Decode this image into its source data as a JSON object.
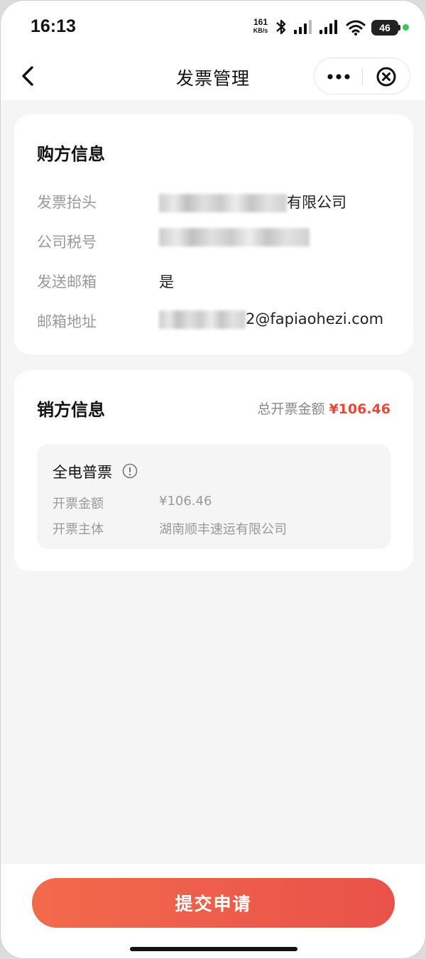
{
  "status_bar": {
    "time": "16:13",
    "net_speed_value": "161",
    "net_speed_unit": "KB/s",
    "battery": "46",
    "icons": [
      "bluetooth-icon",
      "signal-icon",
      "signal-icon",
      "wifi-icon",
      "battery-icon"
    ]
  },
  "nav": {
    "title": "发票管理",
    "icons": [
      "back-icon",
      "more-icon",
      "close-icon"
    ]
  },
  "buyer": {
    "title": "购方信息",
    "rows": [
      {
        "label": "发票抬头",
        "value": "有限公司"
      },
      {
        "label": "公司税号",
        "value": ""
      },
      {
        "label": "发送邮箱",
        "value": "是"
      },
      {
        "label": "邮箱地址",
        "value": "2@fapiaohezi.com"
      }
    ]
  },
  "seller": {
    "title": "销方信息",
    "total_label": "总开票金额",
    "total_amount": "¥106.46",
    "invoice": {
      "type": "全电普票",
      "amount_label": "开票金额",
      "amount_value": "¥106.46",
      "issuer_label": "开票主体",
      "issuer_value": "湖南顺丰速运有限公司"
    }
  },
  "footer": {
    "submit_label": "提交申请"
  },
  "colors": {
    "accent": "#e8483a",
    "button_start": "#f26a4b",
    "button_end": "#e9524a",
    "background": "#f5f5f5"
  }
}
